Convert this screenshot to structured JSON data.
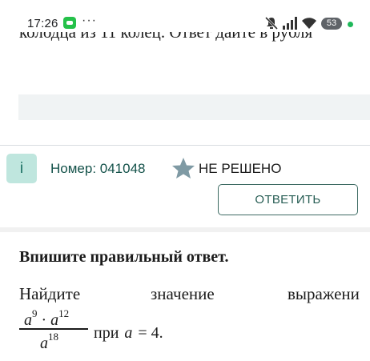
{
  "status_bar": {
    "time": "17:26",
    "overflow": "···",
    "battery": "53",
    "icons": [
      "chat-app-icon",
      "mute-icon",
      "signal-icon",
      "wifi-icon",
      "battery-icon",
      "notification-dot-icon"
    ]
  },
  "previous_task": {
    "text_fragment": "колодца из 11 колец. Ответ дайте в рубля"
  },
  "task": {
    "info_icon": "i",
    "number_label": "Номер: 041048",
    "status": "НЕ РЕШЕНО",
    "answer_button": "ОТВЕТИТЬ",
    "heading": "Впишите правильный ответ.",
    "text_words": [
      "Найдите",
      "значение",
      "выражени"
    ],
    "formula": {
      "num_base1": "a",
      "num_exp1": "9",
      "dot": "·",
      "num_base2": "a",
      "num_exp2": "12",
      "den_base": "a",
      "den_exp": "18",
      "condition_prefix": "при",
      "condition_var": "a",
      "condition_rest": "= 4."
    }
  },
  "colors": {
    "accent": "#1a6f61",
    "info_bg": "#bfe6de",
    "star": "#7f9aa4",
    "button_border": "#3d6b63",
    "answer_field_bg": "#f0f3f4"
  }
}
